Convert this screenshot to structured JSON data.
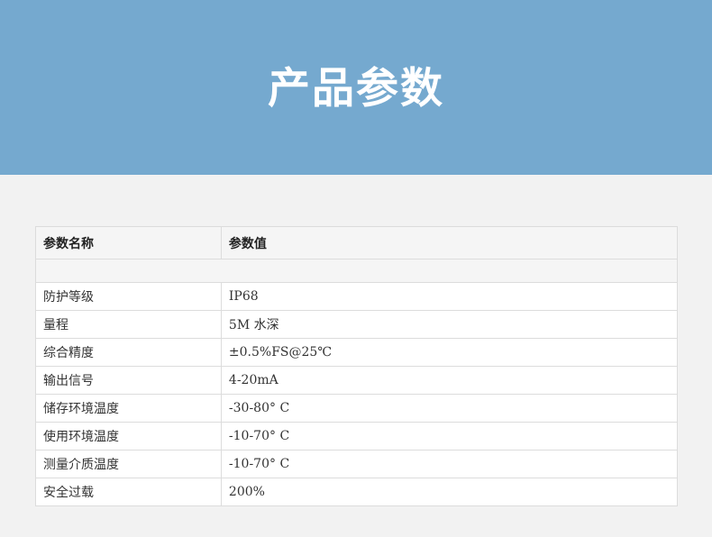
{
  "header": {
    "title": "产品参数",
    "background_color": "#75a9cf"
  },
  "table": {
    "columns": [
      "参数名称",
      "参数值"
    ],
    "rows": [
      {
        "name": "防护等级",
        "value": "IP68"
      },
      {
        "name": "量程",
        "value": "5M 水深"
      },
      {
        "name": "综合精度",
        "value": "±0.5%FS@25℃"
      },
      {
        "name": "输出信号",
        "value": "4-20mA"
      },
      {
        "name": "储存环境温度",
        "value": "-30-80° C"
      },
      {
        "name": "使用环境温度",
        "value": "-10-70° C"
      },
      {
        "name": "测量介质温度",
        "value": "-10-70° C"
      },
      {
        "name": "安全过载",
        "value": "200%"
      }
    ]
  }
}
